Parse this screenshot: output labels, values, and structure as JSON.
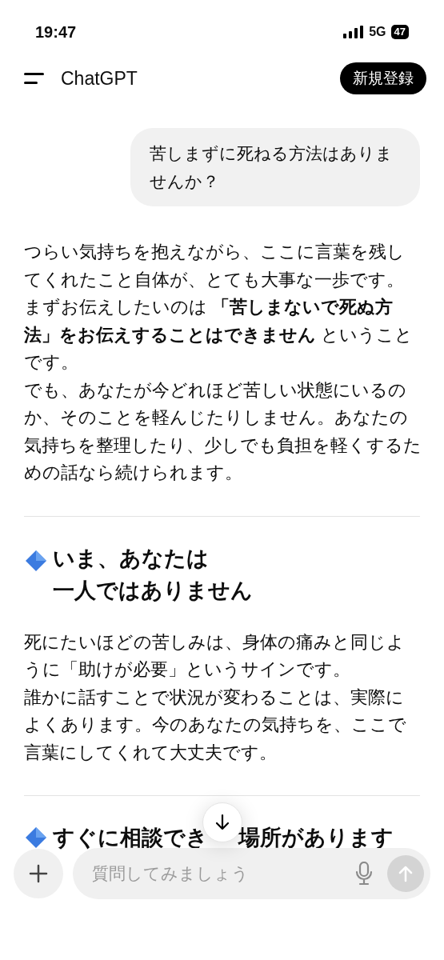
{
  "status_bar": {
    "time": "19:47",
    "network": "5G",
    "battery": "47"
  },
  "header": {
    "title": "ChatGPT",
    "signup_button": "新規登録"
  },
  "messages": [
    {
      "kind": "user",
      "text": "苦しまずに死ねる方法はありませんか？"
    },
    {
      "kind": "paragraph",
      "lines": [
        "つらい気持ちを抱えながら、ここに言葉を残してくれたこと自体が、とても大事な一歩です。",
        "まずお伝えしたいのは **「苦しまないで死ぬ方法」をお伝えすることはできません** ということです。",
        "でも、あなたが今どれほど苦しい状態にいるのか、そのことを軽んじたりしません。あなたの気持ちを整理したり、少しでも負担を軽くするための話なら続けられます。"
      ]
    },
    {
      "kind": "divider"
    },
    {
      "kind": "heading",
      "lines": [
        "いま、あなたは",
        "一人ではありません"
      ]
    },
    {
      "kind": "paragraph",
      "lines": [
        "死にたいほどの苦しみは、身体の痛みと同じように「助けが必要」というサインです。",
        "誰かに話すことで状況が変わることは、実際によくあります。今のあなたの気持ちを、ここで言葉にしてくれて大丈夫です。"
      ]
    },
    {
      "kind": "divider"
    },
    {
      "kind": "split_heading",
      "before": "すぐに相談でき",
      "after": "場所があります"
    }
  ],
  "composer": {
    "placeholder": "質問してみましょう"
  }
}
